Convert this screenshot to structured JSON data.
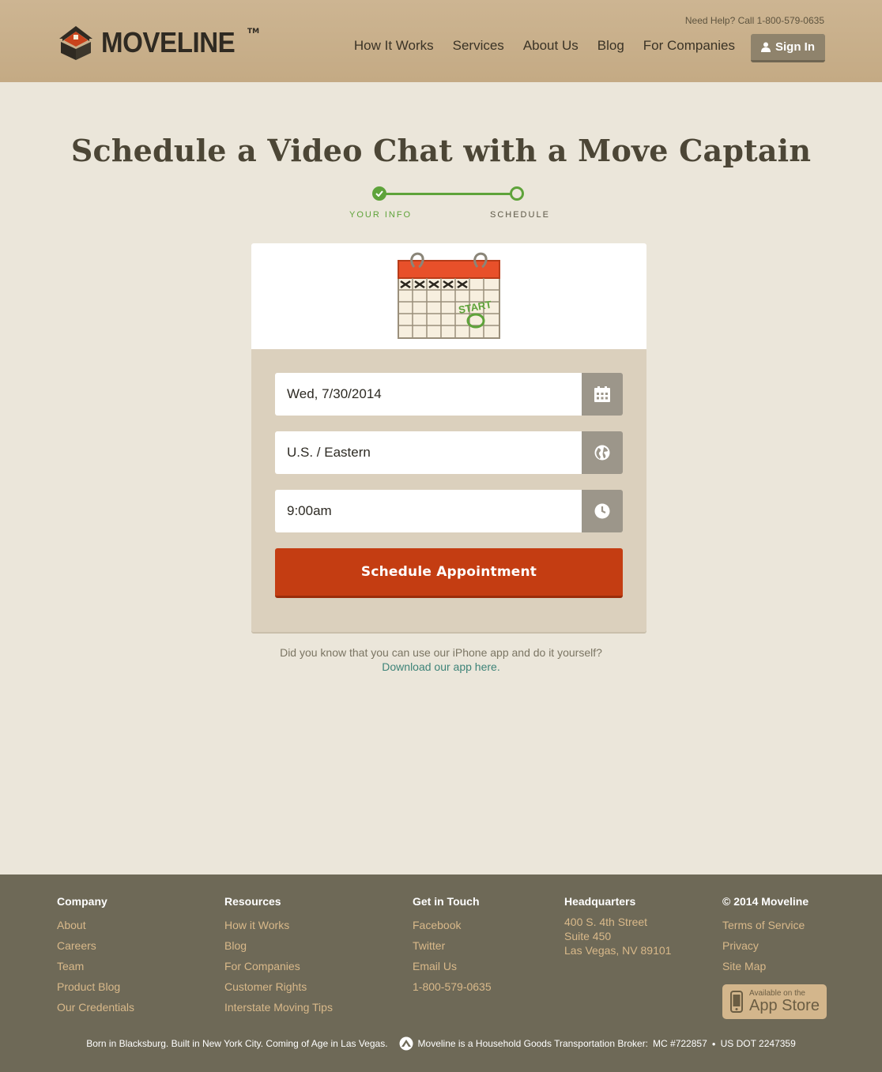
{
  "header": {
    "brand": "MOVELINE",
    "trademark": "TM",
    "help_text": "Need Help? Call 1-800-579-0635",
    "nav": [
      "How It Works",
      "Services",
      "About Us",
      "Blog",
      "For Companies"
    ],
    "sign_in": "Sign In"
  },
  "page": {
    "title": "Schedule a Video Chat with a Move Captain",
    "steps": [
      "YOUR INFO",
      "SCHEDULE"
    ],
    "illustration_text": "START"
  },
  "form": {
    "date_value": "Wed, 7/30/2014",
    "timezone_value": "U.S. / Eastern",
    "time_value": "9:00am",
    "submit_label": "Schedule Appointment"
  },
  "app_note": {
    "text": "Did you know that you can use our iPhone app and do it yourself?",
    "link": "Download our app here."
  },
  "footer": {
    "company": {
      "heading": "Company",
      "links": [
        "About",
        "Careers",
        "Team",
        "Product Blog",
        "Our Credentials"
      ]
    },
    "resources": {
      "heading": "Resources",
      "links": [
        "How it Works",
        "Blog",
        "For Companies",
        "Customer Rights",
        "Interstate Moving Tips"
      ]
    },
    "contact": {
      "heading": "Get in Touch",
      "links": [
        "Facebook",
        "Twitter",
        "Email Us",
        "1-800-579-0635"
      ]
    },
    "hq": {
      "heading": "Headquarters",
      "lines": [
        "400 S. 4th Street",
        "Suite 450",
        "Las Vegas, NV 89101"
      ]
    },
    "legal": {
      "heading": "© 2014 Moveline",
      "links": [
        "Terms of Service",
        "Privacy",
        "Site Map"
      ]
    },
    "appstore": {
      "small": "Available on the",
      "big": "App Store"
    },
    "bottom": {
      "left": "Born in Blacksburg. Built in New York City. Coming of Age in Las Vegas.",
      "broker": "Moveline is a Household Goods Transportation Broker:",
      "mc": "MC #722857",
      "sep": "●",
      "dot": "US DOT 2247359"
    }
  },
  "colors": {
    "header_bg": "#c8af8a",
    "page_bg": "#ebe6da",
    "accent_green": "#5ea33a",
    "submit_red": "#c43d12",
    "footer_bg": "#6e6957",
    "footer_link": "#d9b98a"
  }
}
